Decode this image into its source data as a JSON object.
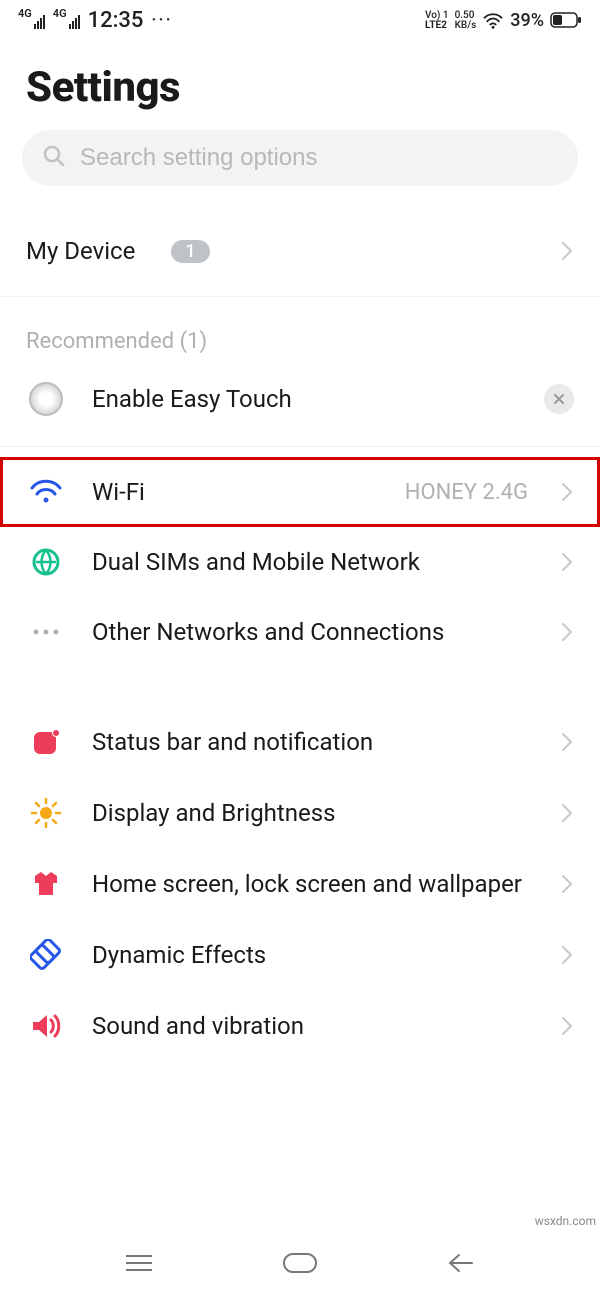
{
  "statusbar": {
    "sig1_label": "4G",
    "sig2_label": "4G",
    "time": "12:35",
    "more": "···",
    "volte_top": "Vo) 1",
    "volte_bot": "LTE2",
    "speed_top": "0.50",
    "speed_bot": "KB/s",
    "battery_pct": "39%"
  },
  "header": {
    "title": "Settings"
  },
  "search": {
    "placeholder": "Search setting options"
  },
  "my_device": {
    "label": "My Device",
    "badge": "1"
  },
  "recommended": {
    "title": "Recommended (1)",
    "item_label": "Enable Easy Touch"
  },
  "network": {
    "wifi": {
      "label": "Wi-Fi",
      "value": "HONEY 2.4G"
    },
    "sims": {
      "label": "Dual SIMs and Mobile Network"
    },
    "other": {
      "label": "Other Networks and Connections"
    }
  },
  "display_group": {
    "status_bar": {
      "label": "Status bar and notification"
    },
    "display": {
      "label": "Display and Brightness"
    },
    "home": {
      "label": "Home screen, lock screen and wallpaper"
    },
    "dynamic": {
      "label": "Dynamic Effects"
    },
    "sound": {
      "label": "Sound and vibration"
    }
  },
  "watermark": "wsxdn.com"
}
